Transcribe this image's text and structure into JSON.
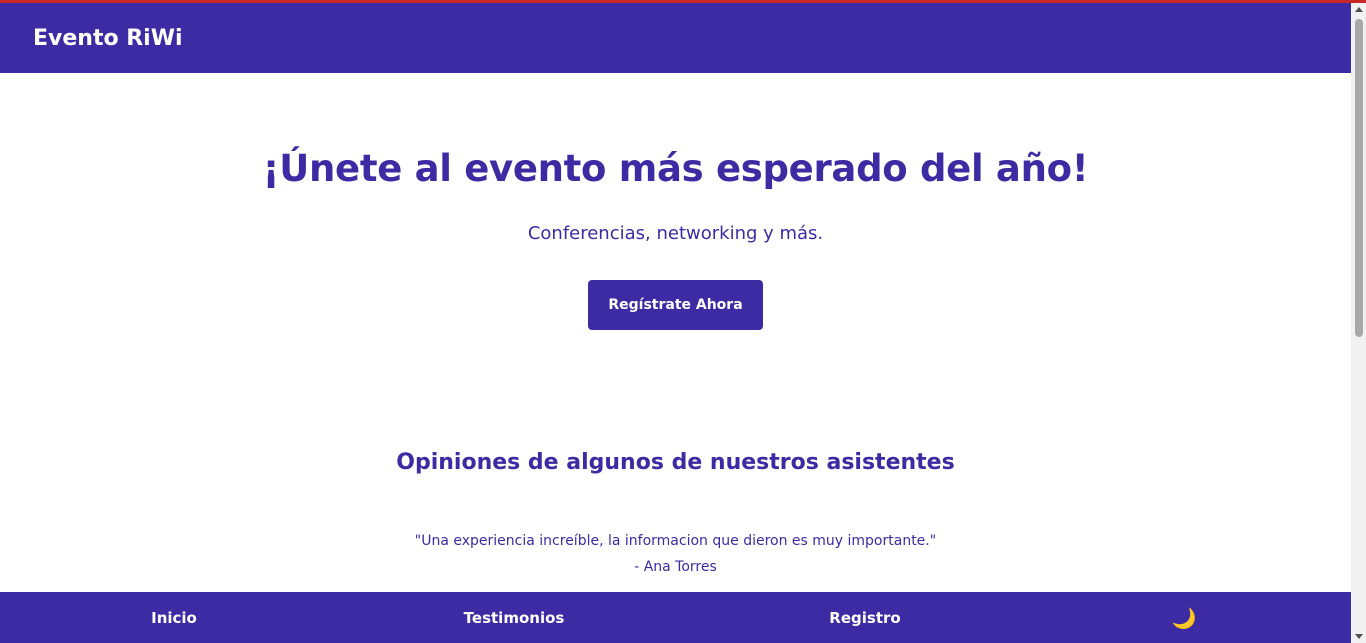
{
  "header": {
    "brand": "Evento RiWi"
  },
  "hero": {
    "title": "¡Únete al evento más esperado del año!",
    "subtitle": "Conferencias, networking y más.",
    "cta_label": "Regístrate Ahora"
  },
  "testimonials": {
    "title": "Opiniones de algunos de nuestros asistentes",
    "items": [
      {
        "quote": "\"Una experiencia increíble, la informacion que dieron es muy importante.\"",
        "author": "- Ana Torres"
      }
    ]
  },
  "nav": {
    "items": [
      {
        "label": "Inicio"
      },
      {
        "label": "Testimonios"
      },
      {
        "label": "Registro"
      }
    ],
    "theme_toggle": "🌙",
    "theme_icon": "moon-icon"
  },
  "colors": {
    "primary": "#3c2ba3",
    "background": "#ffffff",
    "top_accent": "#c62828"
  }
}
